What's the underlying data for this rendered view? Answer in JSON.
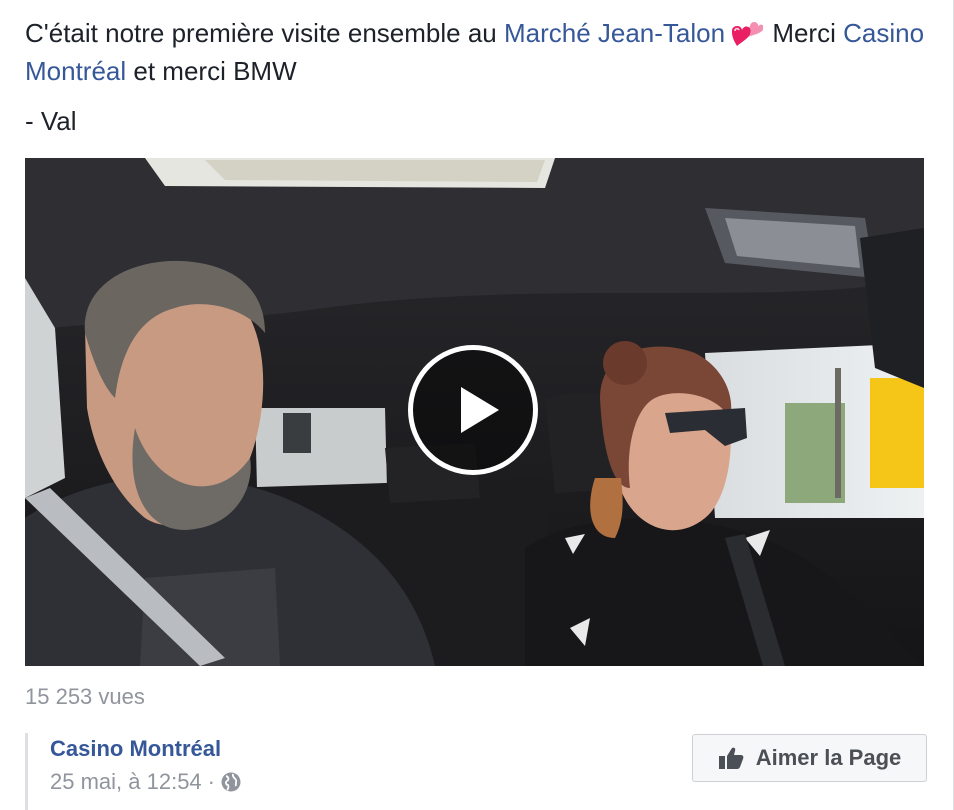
{
  "post": {
    "text_part1": "C'était notre première visite ensemble au ",
    "link_market": "Marché Jean-Talon",
    "emoji": "two-hearts-icon",
    "text_part2": " Merci ",
    "link_casino": "Casino Montréal",
    "text_part3": " et merci BMW",
    "signature": "- Val"
  },
  "video": {
    "play_icon": "play-icon"
  },
  "stats": {
    "views": "15 253 vues"
  },
  "footer": {
    "page_name": "Casino Montréal",
    "date": "25 mai, à 12:54",
    "separator": "·",
    "privacy_icon": "globe-icon",
    "like_button_icon": "thumbs-up-icon",
    "like_button_label": "Aimer la Page"
  },
  "colors": {
    "link": "#365899",
    "text": "#1d2129",
    "muted": "#90949c",
    "button_bg": "#f6f7f9"
  }
}
